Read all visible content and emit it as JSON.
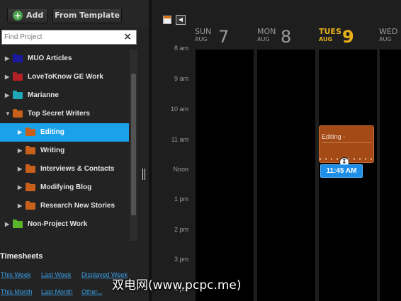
{
  "toolbar": {
    "add_label": "Add",
    "template_label": "From Template"
  },
  "search": {
    "placeholder": "Find Project",
    "clear_glyph": "×"
  },
  "projects": [
    {
      "label": "MUO Articles",
      "color": "#1a1aa0",
      "expanded": false,
      "indent": 0
    },
    {
      "label": "LoveToKnow GE Work",
      "color": "#b21f24",
      "expanded": false,
      "indent": 0
    },
    {
      "label": "Marianne",
      "color": "#1fa7b8",
      "expanded": false,
      "indent": 0
    },
    {
      "label": "Top Secret Writers",
      "color": "#c8601c",
      "expanded": true,
      "indent": 0
    },
    {
      "label": "Editing",
      "color": "#c8601c",
      "expanded": false,
      "indent": 1,
      "selected": true
    },
    {
      "label": "Writing",
      "color": "#c8601c",
      "expanded": false,
      "indent": 1
    },
    {
      "label": "Interviews & Contacts",
      "color": "#c8601c",
      "expanded": false,
      "indent": 1
    },
    {
      "label": "Modifying Blog",
      "color": "#c8601c",
      "expanded": false,
      "indent": 1
    },
    {
      "label": "Research New Stories",
      "color": "#c8601c",
      "expanded": false,
      "indent": 1
    },
    {
      "label": "Non-Project Work",
      "color": "#5bb52a",
      "expanded": false,
      "indent": 0
    }
  ],
  "timesheets": {
    "heading": "Timesheets",
    "links": [
      "This Week",
      "Last Week",
      "Displayed Week",
      "This Month",
      "Last Month",
      "Other..."
    ]
  },
  "calendar": {
    "days": [
      {
        "dow": "SUN",
        "month": "AUG",
        "date": "7",
        "today": false
      },
      {
        "dow": "MON",
        "month": "AUG",
        "date": "8",
        "today": false
      },
      {
        "dow": "TUES",
        "month": "AUG",
        "date": "9",
        "today": true
      },
      {
        "dow": "WED",
        "month": "AUG",
        "date": "",
        "today": false
      }
    ],
    "hours": [
      "8 am",
      "9 am",
      "10 am",
      "11 am",
      "Noon",
      "1 pm",
      "2 pm",
      "3 pm",
      "4 pm"
    ],
    "event": {
      "title": "Editing -",
      "color": "#a44a16",
      "drag_time": "11:45 AM"
    }
  },
  "watermark": "双电网(www.pcpc.me)",
  "icons": {
    "add": "plus-circle-icon",
    "today": "calendar-today-icon",
    "back": "arrow-left-icon",
    "move": "move-cursor-icon"
  }
}
